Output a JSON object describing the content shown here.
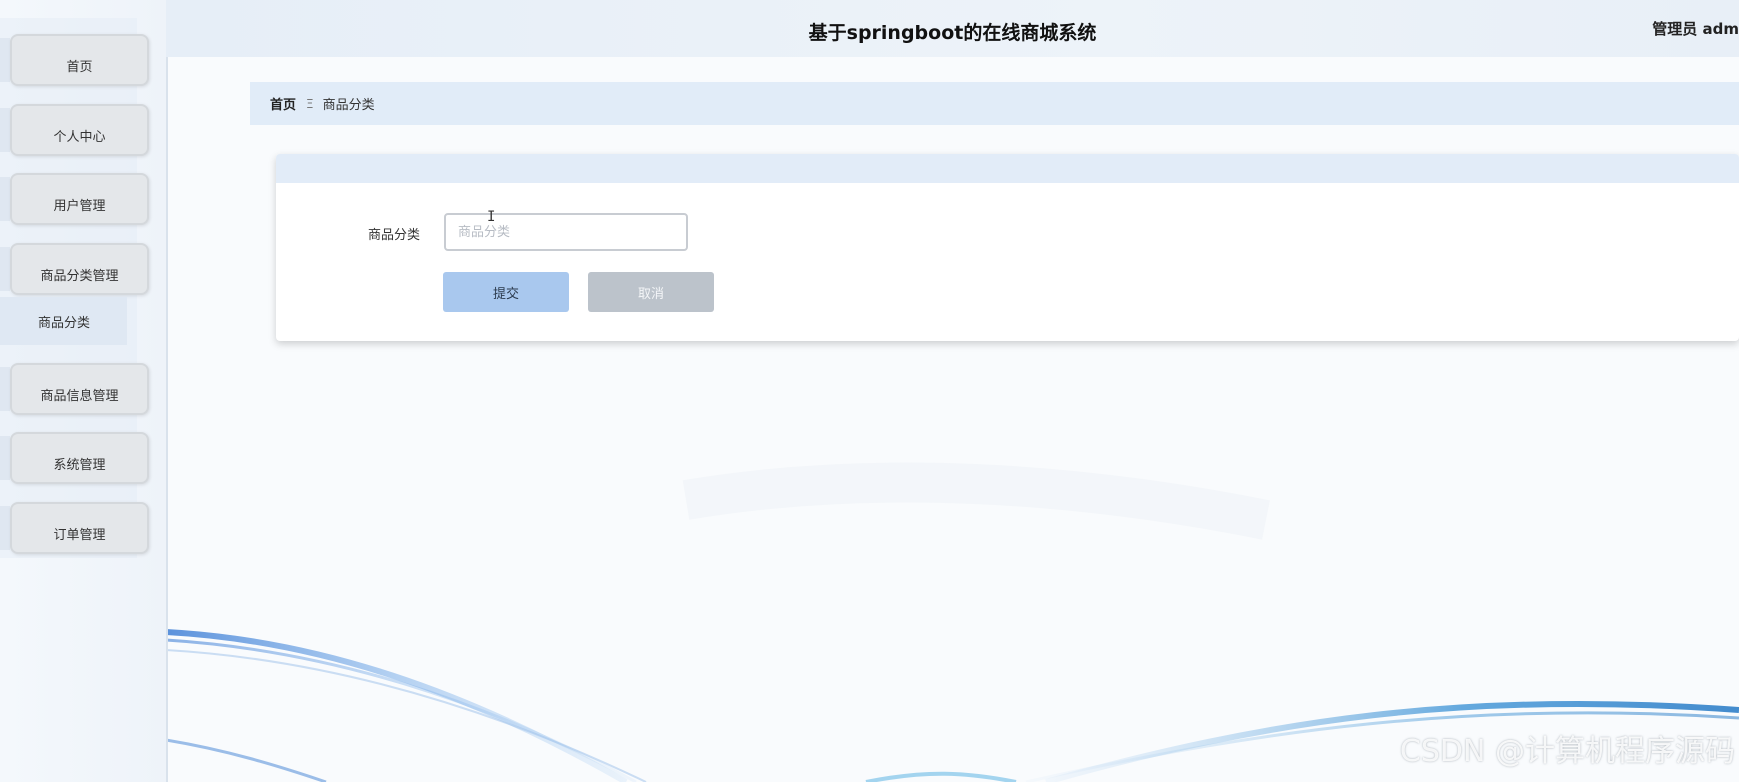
{
  "header": {
    "title": "基于springboot的在线商城系统",
    "user_label": "管理员 adm"
  },
  "sidebar": {
    "items": [
      {
        "label": "首页"
      },
      {
        "label": "个人中心"
      },
      {
        "label": "用户管理"
      },
      {
        "label": "商品分类管理"
      },
      {
        "label": "商品信息管理"
      },
      {
        "label": "系统管理"
      },
      {
        "label": "订单管理"
      }
    ],
    "submenu_active": "商品分类"
  },
  "breadcrumb": {
    "home": "首页",
    "separator": "Ξ",
    "current": "商品分类"
  },
  "form": {
    "field_label": "商品分类",
    "field_value": "",
    "field_placeholder": "商品分类",
    "submit_label": "提交",
    "cancel_label": "取消"
  },
  "watermark": "CSDN @计算机程序源码",
  "colors": {
    "accent": "#a9c8ee",
    "header_bg": "#e6eef7",
    "breadcrumb_bg": "#e1ecf8",
    "wave_blue": "#4a90d9"
  }
}
